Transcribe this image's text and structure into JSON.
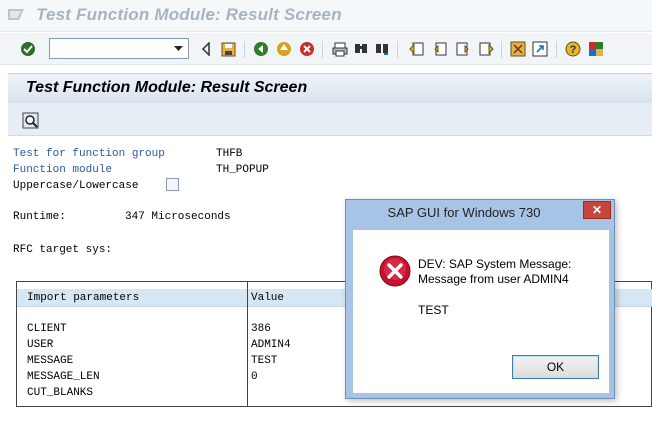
{
  "window": {
    "title": "Test Function Module: Result Screen"
  },
  "toolbar": {
    "command_field_value": "",
    "icons": [
      "enter-icon",
      "back-nav-icon",
      "save-icon",
      "back-icon",
      "exit-icon",
      "cancel-icon",
      "print-icon",
      "find-icon",
      "find-next-icon",
      "first-page-icon",
      "previous-page-icon",
      "next-page-icon",
      "last-page-icon",
      "create-session-icon",
      "create-shortcut-icon",
      "help-icon",
      "customize-layout-icon"
    ]
  },
  "screen": {
    "title": "Test Function Module: Result Screen",
    "appbar_icons": [
      "display-icon"
    ]
  },
  "fields": {
    "function_group_label": "Test for function group",
    "function_group_value": "THFB",
    "function_module_label": "Function module",
    "function_module_value": "TH_POPUP",
    "uppercase_label": "Uppercase/Lowercase",
    "runtime_label": "Runtime:",
    "runtime_value": "347 Microseconds",
    "rfc_label": "RFC target sys:"
  },
  "import_table": {
    "headers": [
      "Import parameters",
      "Value"
    ],
    "rows": [
      {
        "param": "CLIENT",
        "value": "386"
      },
      {
        "param": "USER",
        "value": "ADMIN4"
      },
      {
        "param": "MESSAGE",
        "value": "TEST"
      },
      {
        "param": "MESSAGE_LEN",
        "value": "0"
      },
      {
        "param": "CUT_BLANKS",
        "value": ""
      }
    ]
  },
  "dialog": {
    "title": "SAP GUI for Windows 730",
    "message_line1": "DEV: SAP System Message:",
    "message_line2": "Message from user ADMIN4",
    "message_body": "TEST",
    "ok_label": "OK",
    "close_label": "✕"
  },
  "colors": {
    "label_blue": "#2a5aa0",
    "table_header": "#d7e6f3",
    "dialog_frame": "#a7c4e6",
    "close_red": "#c7463b"
  }
}
